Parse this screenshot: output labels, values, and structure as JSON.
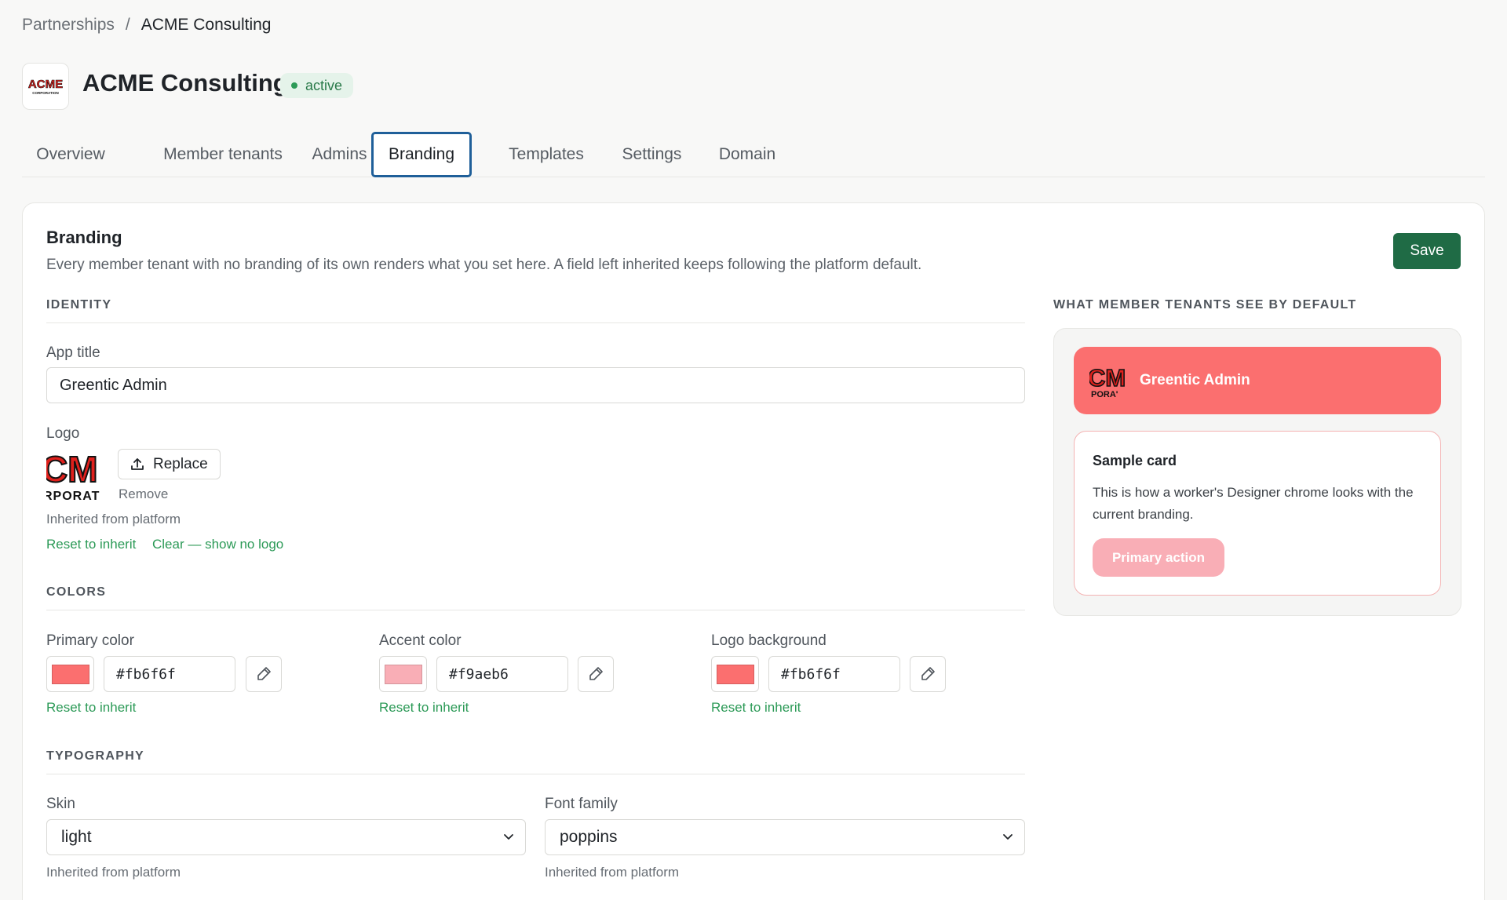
{
  "breadcrumb": {
    "parent": "Partnerships",
    "separator": "/",
    "current": "ACME Consulting"
  },
  "header": {
    "title": "ACME Consulting",
    "status": "active",
    "logo_text": "ACME",
    "logo_subtext": "CORPORATION"
  },
  "tabs": [
    {
      "label": "Overview"
    },
    {
      "label": "Member tenants"
    },
    {
      "label": "Admins"
    },
    {
      "label": "Branding",
      "active": true
    },
    {
      "label": "Templates"
    },
    {
      "label": "Settings"
    },
    {
      "label": "Domain"
    }
  ],
  "branding": {
    "title": "Branding",
    "description": "Every member tenant with no branding of its own renders what you set here. A field left inherited keeps following the platform default.",
    "save_label": "Save"
  },
  "identity": {
    "heading": "IDENTITY",
    "app_title_label": "App title",
    "app_title_value": "Greentic Admin",
    "logo_label": "Logo",
    "logo_glyph_top": "CM",
    "logo_glyph_bottom": "RPORAT",
    "replace_label": "Replace",
    "remove_label": "Remove",
    "inherited_note": "Inherited from platform",
    "reset_label": "Reset to inherit",
    "clear_label": "Clear — show no logo"
  },
  "colors": {
    "heading": "COLORS",
    "fields": [
      {
        "label": "Primary color",
        "value": "#fb6f6f",
        "reset": "Reset to inherit"
      },
      {
        "label": "Accent color",
        "value": "#f9aeb6",
        "reset": "Reset to inherit"
      },
      {
        "label": "Logo background",
        "value": "#fb6f6f",
        "reset": "Reset to inherit"
      }
    ]
  },
  "typography": {
    "heading": "TYPOGRAPHY",
    "skin_label": "Skin",
    "skin_value": "light",
    "skin_note": "Inherited from platform",
    "font_label": "Font family",
    "font_value": "poppins",
    "font_note": "Inherited from platform"
  },
  "preview": {
    "heading": "WHAT MEMBER TENANTS SEE BY DEFAULT",
    "app_title": "Greentic Admin",
    "logo_glyph_top": "CM",
    "logo_glyph_bottom": "PORA'",
    "card_title": "Sample card",
    "card_body": "This is how a worker's Designer chrome looks with the current branding.",
    "action_label": "Primary action"
  },
  "theme": {
    "primary": "#fb6f6f",
    "accent": "#f9aeb6",
    "save": "#1f6b45",
    "link": "#2c9a57"
  }
}
